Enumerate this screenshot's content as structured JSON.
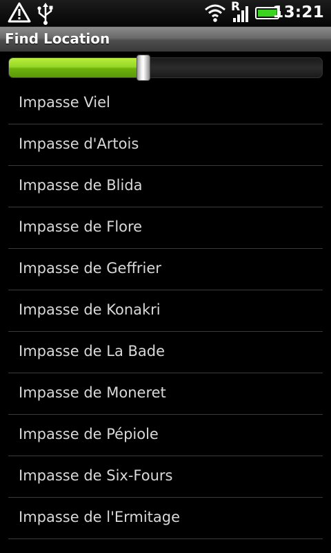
{
  "status_bar": {
    "time": "13:21",
    "icons": [
      "warning-icon",
      "usb-icon",
      "wifi-icon",
      "roaming-signal-icon",
      "battery-icon"
    ],
    "roaming_indicator": "R",
    "battery_color": "#3bd31f"
  },
  "title_bar": {
    "title": "Find Location"
  },
  "seekbar": {
    "progress": 0.43,
    "fill_color": "#8bcc20"
  },
  "locations": [
    "Impasse Viel",
    "Impasse d'Artois",
    "Impasse de Blida",
    "Impasse de Flore",
    "Impasse de Geffrier",
    "Impasse de Konakri",
    "Impasse de La Bade",
    "Impasse de Moneret",
    "Impasse de Pépiole",
    "Impasse de Six-Fours",
    "Impasse de l'Ermitage"
  ]
}
